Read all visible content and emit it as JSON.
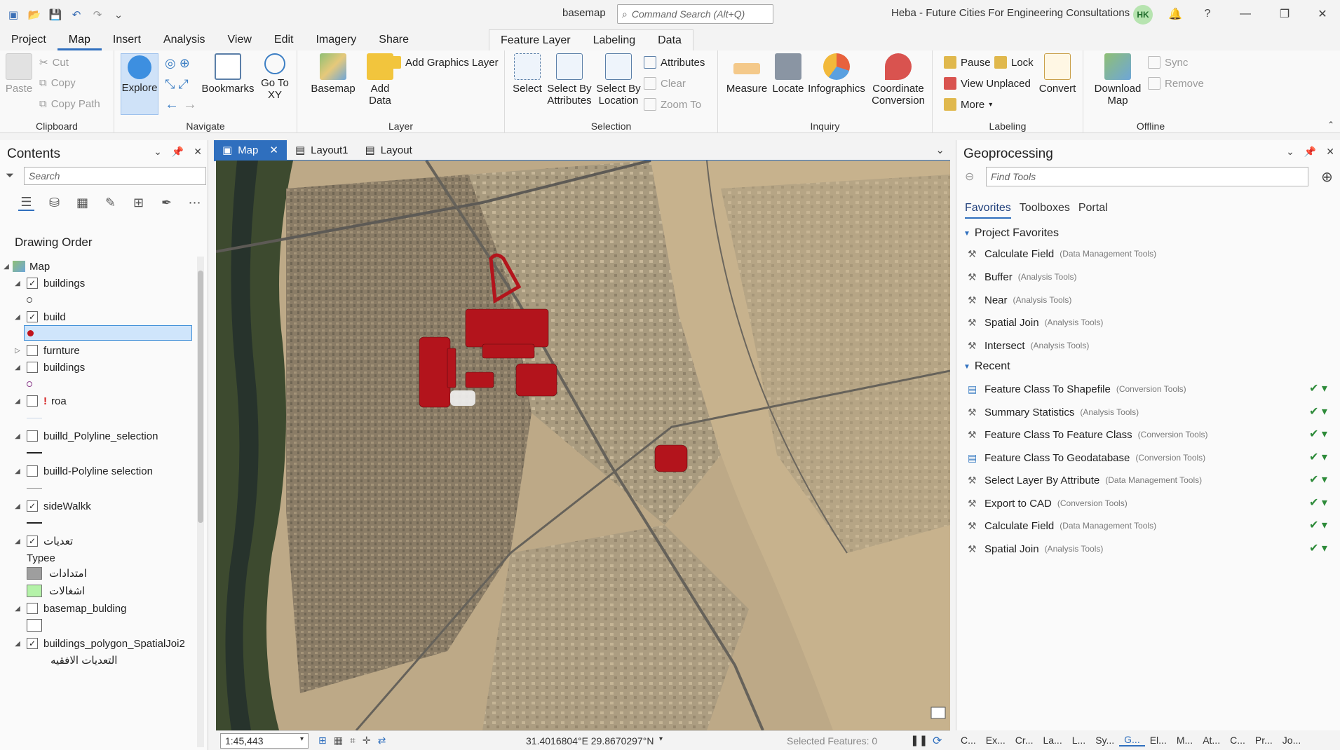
{
  "app": {
    "project_name": "basemap",
    "command_search_placeholder": "Command Search (Alt+Q)",
    "user_name": "Heba - Future Cities For Engineering Consultations",
    "avatar_initials": "HK"
  },
  "ribbon": {
    "tabs": [
      "Project",
      "Map",
      "Insert",
      "Analysis",
      "View",
      "Edit",
      "Imagery",
      "Share"
    ],
    "active_tab": "Map",
    "context_tabs": [
      "Feature Layer",
      "Labeling",
      "Data"
    ],
    "clipboard": {
      "label": "Clipboard",
      "paste": "Paste",
      "cut": "Cut",
      "copy": "Copy",
      "copy_path": "Copy Path"
    },
    "navigate": {
      "label": "Navigate",
      "explore": "Explore",
      "bookmarks": "Bookmarks",
      "go_to_xy": "Go To XY"
    },
    "layer": {
      "label": "Layer",
      "basemap": "Basemap",
      "add_data": "Add Data",
      "add_graphics": "Add Graphics Layer"
    },
    "selection": {
      "label": "Selection",
      "select": "Select",
      "select_by_attr": "Select By Attributes",
      "select_by_loc": "Select By Location",
      "attributes": "Attributes",
      "clear": "Clear",
      "zoom_to": "Zoom To"
    },
    "inquiry": {
      "label": "Inquiry",
      "measure": "Measure",
      "locate": "Locate",
      "infographics": "Infographics",
      "coord_conv": "Coordinate Conversion"
    },
    "labeling": {
      "label": "Labeling",
      "pause": "Pause",
      "lock": "Lock",
      "view_unplaced": "View Unplaced",
      "more": "More",
      "convert": "Convert"
    },
    "offline": {
      "label": "Offline",
      "download_map": "Download Map",
      "sync": "Sync",
      "remove": "Remove"
    }
  },
  "contents": {
    "title": "Contents",
    "search_placeholder": "Search",
    "drawing_order": "Drawing Order",
    "layers": [
      {
        "name": "Map",
        "checked": null,
        "expanded": true,
        "indent": 0
      },
      {
        "name": "buildings",
        "checked": true,
        "expanded": true,
        "indent": 1
      },
      {
        "name": "build",
        "checked": true,
        "expanded": true,
        "indent": 1
      },
      {
        "name": "furnture",
        "checked": false,
        "expanded": false,
        "indent": 1
      },
      {
        "name": "buildings",
        "checked": false,
        "expanded": true,
        "indent": 1
      },
      {
        "name": "roa",
        "checked": false,
        "expanded": true,
        "indent": 1,
        "warning": true
      },
      {
        "name": "builld_Polyline_selection",
        "checked": false,
        "expanded": true,
        "indent": 1
      },
      {
        "name": "builld-Polyline selection",
        "checked": false,
        "expanded": true,
        "indent": 1
      },
      {
        "name": "sideWalkk",
        "checked": true,
        "expanded": true,
        "indent": 1
      },
      {
        "name": "تعديات",
        "checked": true,
        "expanded": true,
        "indent": 1
      },
      {
        "name": "basemap_bulding",
        "checked": false,
        "expanded": true,
        "indent": 1
      },
      {
        "name": "buildings_polygon_SpatialJoi2",
        "checked": true,
        "expanded": true,
        "indent": 1
      }
    ],
    "legend_field": "Typee",
    "legend_items": [
      {
        "label": "امتدادات",
        "color": "#9e9e9e"
      },
      {
        "label": "اشغالات",
        "color": "#b4f2a8"
      }
    ],
    "last_label": "التعديات الافقيه"
  },
  "map_view": {
    "tabs": [
      {
        "label": "Map",
        "active": true
      },
      {
        "label": "Layout1",
        "active": false
      },
      {
        "label": "Layout",
        "active": false
      }
    ],
    "scale": "1:45,443",
    "coordinates": "31.4016804°E 29.8670297°N",
    "selected_features": "Selected Features: 0"
  },
  "geoprocessing": {
    "title": "Geoprocessing",
    "search_placeholder": "Find Tools",
    "tabs": [
      "Favorites",
      "Toolboxes",
      "Portal"
    ],
    "active_tab": "Favorites",
    "favorites_header": "Project Favorites",
    "favorites": [
      {
        "name": "Calculate Field",
        "toolbox": "(Data Management Tools)"
      },
      {
        "name": "Buffer",
        "toolbox": "(Analysis Tools)"
      },
      {
        "name": "Near",
        "toolbox": "(Analysis Tools)"
      },
      {
        "name": "Spatial Join",
        "toolbox": "(Analysis Tools)"
      },
      {
        "name": "Intersect",
        "toolbox": "(Analysis Tools)"
      }
    ],
    "recent_header": "Recent",
    "recent": [
      {
        "name": "Feature Class To Shapefile",
        "toolbox": "(Conversion Tools)",
        "script": true
      },
      {
        "name": "Summary Statistics",
        "toolbox": "(Analysis Tools)"
      },
      {
        "name": "Feature Class To Feature Class",
        "toolbox": "(Conversion Tools)"
      },
      {
        "name": "Feature Class To Geodatabase",
        "toolbox": "(Conversion Tools)",
        "script": true
      },
      {
        "name": "Select Layer By Attribute",
        "toolbox": "(Data Management Tools)"
      },
      {
        "name": "Export to CAD",
        "toolbox": "(Conversion Tools)"
      },
      {
        "name": "Calculate Field",
        "toolbox": "(Data Management Tools)"
      },
      {
        "name": "Spatial Join",
        "toolbox": "(Analysis Tools)"
      }
    ]
  },
  "bottom_tabs": [
    "C...",
    "Ex...",
    "Cr...",
    "La...",
    "L...",
    "Sy...",
    "G...",
    "El...",
    "M...",
    "At...",
    "C...",
    "Pr...",
    "Jo..."
  ],
  "bottom_active": "G..."
}
